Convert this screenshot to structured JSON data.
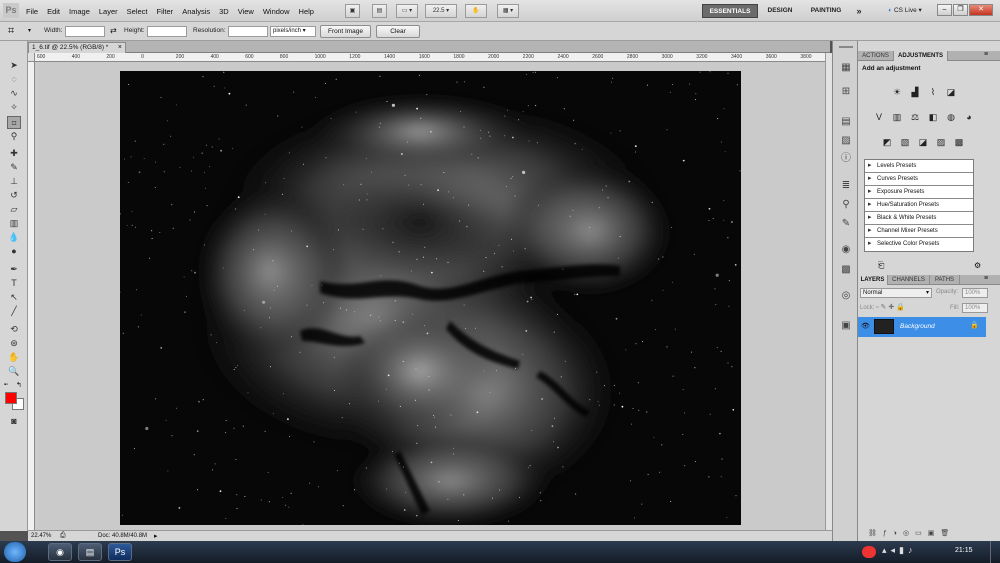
{
  "app": {
    "logo": "Ps"
  },
  "menu": [
    "File",
    "Edit",
    "Image",
    "Layer",
    "Select",
    "Filter",
    "Analysis",
    "3D",
    "View",
    "Window",
    "Help"
  ],
  "menubar_buttons": {
    "zoom_value": "22.5"
  },
  "workspaces": {
    "essentials": "ESSENTIALS",
    "design": "DESIGN",
    "painting": "PAINTING",
    "more": "»",
    "cs_live": "CS Live"
  },
  "options": {
    "width_label": "Width:",
    "height_label": "Height:",
    "resolution_label": "Resolution:",
    "units": "pixels/inch",
    "front_image": "Front Image",
    "clear": "Clear"
  },
  "document": {
    "tab_title": "1_6.tif @ 22.5% (RGB/8) *",
    "close": "×"
  },
  "ruler_h": [
    "600",
    "400",
    "200",
    "0",
    "200",
    "400",
    "600",
    "800",
    "1000",
    "1200",
    "1400",
    "1600",
    "1800",
    "2000",
    "2200",
    "2400",
    "2600",
    "2800",
    "3000",
    "3200",
    "3400",
    "3600",
    "3800"
  ],
  "status": {
    "zoom": "22.47%",
    "doc": "Doc: 40.8M/40.8M"
  },
  "panel": {
    "tabs_top": [
      "ACTIONS",
      "ADJUSTMENTS"
    ],
    "add_adjustment": "Add an adjustment",
    "presets": [
      "Levels Presets",
      "Curves Presets",
      "Exposure Presets",
      "Hue/Saturation Presets",
      "Black & White Presets",
      "Channel Mixer Presets",
      "Selective Color Presets"
    ],
    "tabs_layers": [
      "LAYERS",
      "CHANNELS",
      "PATHS"
    ],
    "blend_mode": "Normal",
    "opacity_label": "Opacity:",
    "opacity_value": "100%",
    "lock_label": "Lock:",
    "fill_label": "Fill:",
    "fill_value": "100%",
    "layer_name": "Background"
  },
  "taskbar": {
    "clock": "21:15"
  },
  "colors": {
    "foreground": "#ff0000",
    "background_swatch": "#ffffff",
    "layer_selected": "#3d8ee6"
  }
}
